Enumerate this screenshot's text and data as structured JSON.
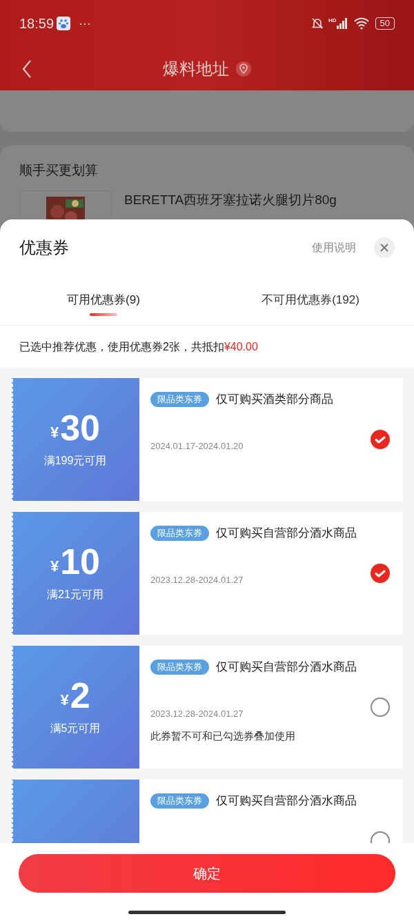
{
  "status_bar": {
    "time": "18:59",
    "more": "···",
    "network": "HD",
    "battery": "50"
  },
  "header": {
    "title": "爆料地址"
  },
  "background": {
    "section_title": "顺手买更划算",
    "product": {
      "name": "BERETTA西班牙塞拉诺火腿切片80g"
    }
  },
  "sheet": {
    "title": "优惠券",
    "help_link": "使用说明",
    "tabs": [
      {
        "label": "可用优惠券(9)",
        "selected": true
      },
      {
        "label": "不可用优惠券(192)",
        "selected": false
      }
    ],
    "summary": "已选中推荐优惠，使用优惠券2张，共抵扣",
    "summary_amount": "¥40.00",
    "coupons": [
      {
        "currency": "¥",
        "amount": "30",
        "condition": "满199元可用",
        "tag": "限品类东券",
        "title": "仅可购买酒类部分商品",
        "validity": "2024.01.17-2024.01.20",
        "selected": true
      },
      {
        "currency": "¥",
        "amount": "10",
        "condition": "满21元可用",
        "tag": "限品类东券",
        "title": "仅可购买自营部分酒水商品",
        "validity": "2023.12.28-2024.01.27",
        "selected": true
      },
      {
        "currency": "¥",
        "amount": "2",
        "condition": "满5元可用",
        "tag": "限品类东券",
        "title": "仅可购买自营部分酒水商品",
        "validity": "2023.12.28-2024.01.27",
        "note": "此券暂不可和已勾选券叠加使用",
        "selected": false
      },
      {
        "tag": "限品类东券",
        "title": "仅可购买自营部分酒水商品",
        "selected": false
      }
    ],
    "confirm": "确定"
  }
}
